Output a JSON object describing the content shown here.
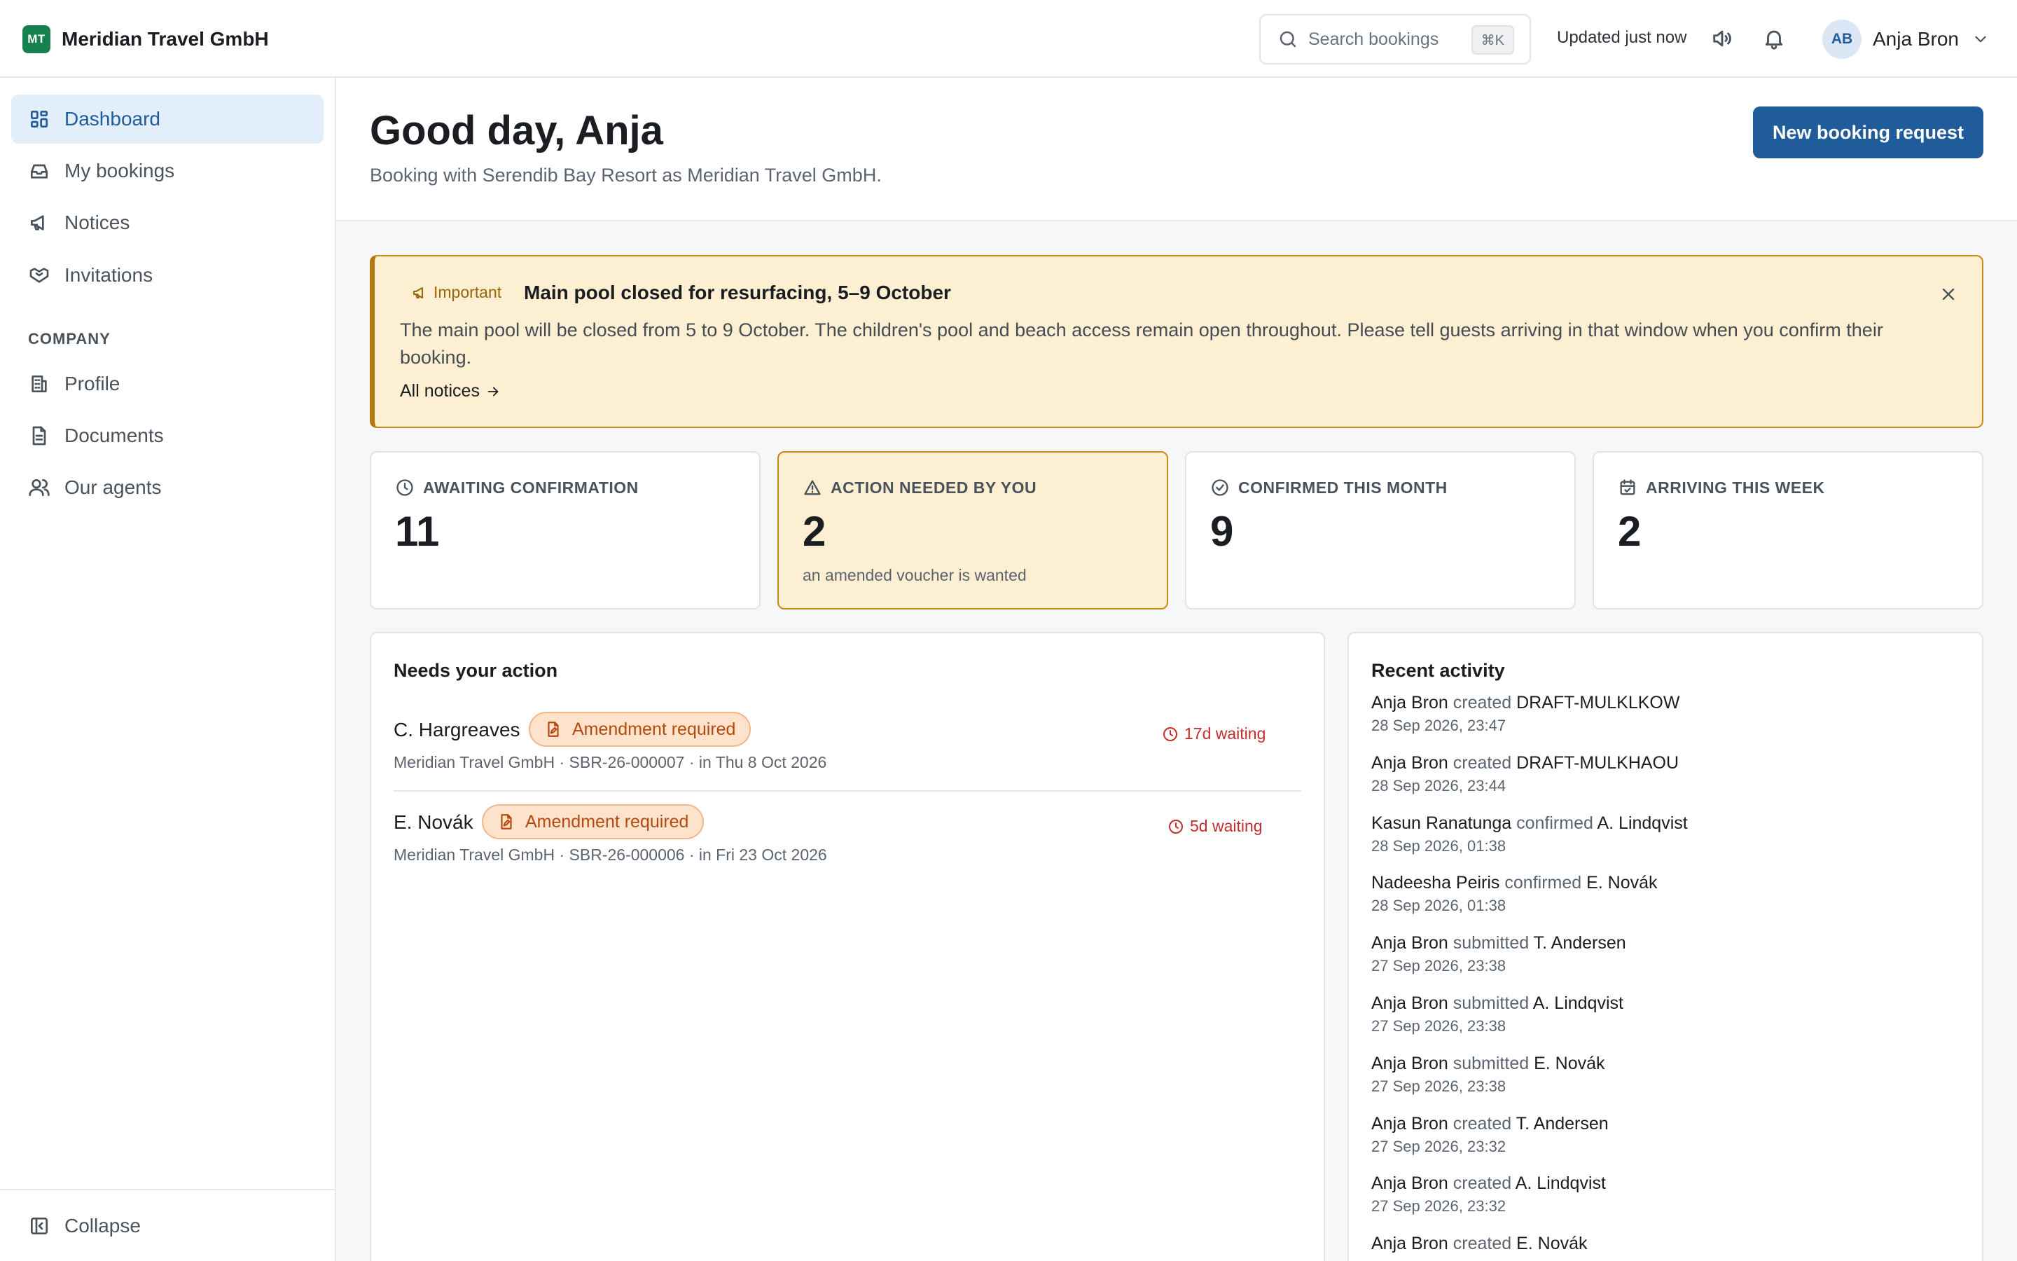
{
  "brand": {
    "initials": "MT",
    "name": "Meridian Travel GmbH",
    "color": "#17804f"
  },
  "search": {
    "placeholder": "Search bookings",
    "shortcut": "⌘K"
  },
  "topbar": {
    "status": "Updated just now",
    "icons": [
      "sound-icon",
      "bell-icon"
    ],
    "user": {
      "initials": "AB",
      "name": "Anja Bron"
    }
  },
  "sidebar": {
    "items": [
      {
        "label": "Dashboard",
        "icon": "dashboard-icon",
        "active": true
      },
      {
        "label": "My bookings",
        "icon": "inbox-icon"
      },
      {
        "label": "Notices",
        "icon": "megaphone-icon"
      },
      {
        "label": "Invitations",
        "icon": "handshake-icon"
      }
    ],
    "section_label": "COMPANY",
    "company_items": [
      {
        "label": "Profile",
        "icon": "building-icon"
      },
      {
        "label": "Documents",
        "icon": "document-icon"
      },
      {
        "label": "Our agents",
        "icon": "users-icon"
      }
    ],
    "collapse_label": "Collapse"
  },
  "header": {
    "greeting": "Good day, Anja",
    "subline": "Booking with Serendib Bay Resort as Meridian Travel GmbH.",
    "primary_button": "New booking request",
    "accent": "#215c9a"
  },
  "notice": {
    "tag": "Important",
    "title": "Main pool closed for resurfacing, 5–9 October",
    "body": "The main pool will be closed from 5 to 9 October. The children's pool and beach access remain open throughout. Please tell guests arriving in that window when you confirm their booking.",
    "link": "All notices"
  },
  "stats": [
    {
      "label": "AWAITING CONFIRMATION",
      "value": "11",
      "icon": "clock-icon"
    },
    {
      "label": "ACTION NEEDED BY YOU",
      "value": "2",
      "note": "an amended voucher is wanted",
      "icon": "warning-icon",
      "highlight": true
    },
    {
      "label": "CONFIRMED THIS MONTH",
      "value": "9",
      "icon": "check-circle-icon"
    },
    {
      "label": "ARRIVING THIS WEEK",
      "value": "2",
      "icon": "calendar-icon"
    }
  ],
  "needs_action": {
    "title": "Needs your action",
    "rows": [
      {
        "guest": "C. Hargreaves",
        "badge": "Amendment required",
        "meta": "Meridian Travel GmbH · SBR-26-000007 · in Thu 8 Oct 2026",
        "waiting": "17d waiting"
      },
      {
        "guest": "E. Novák",
        "badge": "Amendment required",
        "meta": "Meridian Travel GmbH · SBR-26-000006 · in Fri 23 Oct 2026",
        "waiting": "5d waiting"
      }
    ]
  },
  "activity": {
    "title": "Recent activity",
    "items": [
      {
        "actor": "Anja Bron",
        "verb": "created",
        "target": "DRAFT-MULKLKOW",
        "time": "28 Sep 2026, 23:47"
      },
      {
        "actor": "Anja Bron",
        "verb": "created",
        "target": "DRAFT-MULKHAOU",
        "time": "28 Sep 2026, 23:44"
      },
      {
        "actor": "Kasun Ranatunga",
        "verb": "confirmed",
        "target": "A. Lindqvist",
        "time": "28 Sep 2026, 01:38"
      },
      {
        "actor": "Nadeesha Peiris",
        "verb": "confirmed",
        "target": "E. Novák",
        "time": "28 Sep 2026, 01:38"
      },
      {
        "actor": "Anja Bron",
        "verb": "submitted",
        "target": "T. Andersen",
        "time": "27 Sep 2026, 23:38"
      },
      {
        "actor": "Anja Bron",
        "verb": "submitted",
        "target": "A. Lindqvist",
        "time": "27 Sep 2026, 23:38"
      },
      {
        "actor": "Anja Bron",
        "verb": "submitted",
        "target": "E. Novák",
        "time": "27 Sep 2026, 23:38"
      },
      {
        "actor": "Anja Bron",
        "verb": "created",
        "target": "T. Andersen",
        "time": "27 Sep 2026, 23:32"
      },
      {
        "actor": "Anja Bron",
        "verb": "created",
        "target": "A. Lindqvist",
        "time": "27 Sep 2026, 23:32"
      },
      {
        "actor": "Anja Bron",
        "verb": "created",
        "target": "E. Novák",
        "time": ""
      }
    ]
  }
}
